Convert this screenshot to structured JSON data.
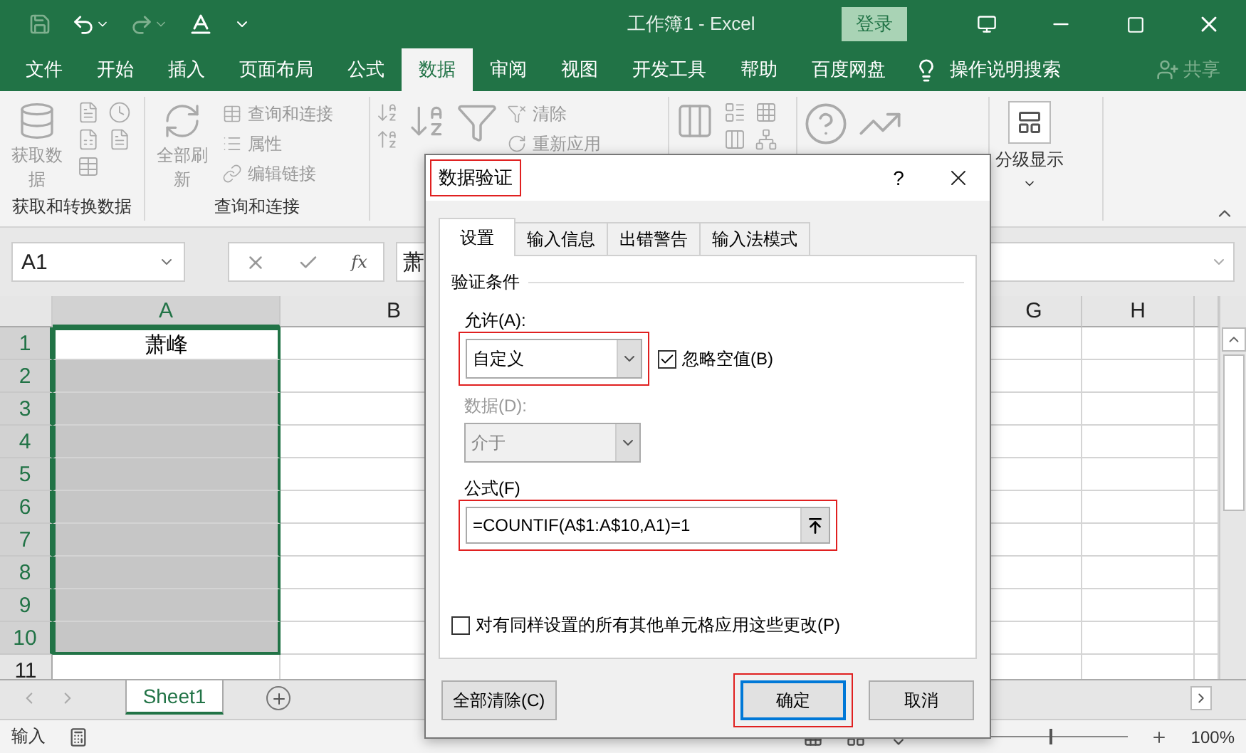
{
  "window": {
    "title": "工作簿1  -  Excel",
    "sign_in": "登录"
  },
  "menu_tabs": [
    {
      "label": "文件",
      "selected": false
    },
    {
      "label": "开始",
      "selected": false
    },
    {
      "label": "插入",
      "selected": false
    },
    {
      "label": "页面布局",
      "selected": false
    },
    {
      "label": "公式",
      "selected": false
    },
    {
      "label": "数据",
      "selected": true
    },
    {
      "label": "审阅",
      "selected": false
    },
    {
      "label": "视图",
      "selected": false
    },
    {
      "label": "开发工具",
      "selected": false
    },
    {
      "label": "帮助",
      "selected": false
    },
    {
      "label": "百度网盘",
      "selected": false
    }
  ],
  "tell_me": "操作说明搜索",
  "share": "共享",
  "ribbon": {
    "get_data": "获取数据",
    "refresh_all": "全部刷新",
    "queries": "查询和连接",
    "properties": "属性",
    "edit_links": "编辑链接",
    "clear": "清除",
    "reapply": "重新应用",
    "outline": "分级显示",
    "groups": [
      "获取和转换数据",
      "查询和连接"
    ]
  },
  "formula_bar": {
    "name_box": "A1",
    "fx": "fx",
    "content": "萧"
  },
  "columns": [
    {
      "label": "A",
      "selected": true
    },
    {
      "label": "B",
      "selected": false
    },
    {
      "label": "G",
      "selected": false
    },
    {
      "label": "H",
      "selected": false
    }
  ],
  "rows": [
    {
      "number": "1",
      "value": "萧峰",
      "selected": true,
      "active": true
    },
    {
      "number": "2",
      "selected": true,
      "active": false
    },
    {
      "number": "3",
      "selected": true,
      "active": false
    },
    {
      "number": "4",
      "selected": true,
      "active": false
    },
    {
      "number": "5",
      "selected": true,
      "active": false
    },
    {
      "number": "6",
      "selected": true,
      "active": false
    },
    {
      "number": "7",
      "selected": true,
      "active": false
    },
    {
      "number": "8",
      "selected": true,
      "active": false
    },
    {
      "number": "9",
      "selected": true,
      "active": false
    },
    {
      "number": "10",
      "selected": true,
      "active": false
    },
    {
      "number": "11",
      "selected": false,
      "active": false
    }
  ],
  "sheets": [
    {
      "label": "Sheet1",
      "selected": true
    }
  ],
  "status_bar": {
    "mode": "输入",
    "zoom": "100%",
    "zoom_slider": {
      "level": 0.5
    }
  },
  "dialog": {
    "title": "数据验证",
    "title_annotated": true,
    "help": "?",
    "tabs": [
      {
        "label": "设置",
        "selected": true
      },
      {
        "label": "输入信息",
        "selected": false
      },
      {
        "label": "出错警告",
        "selected": false
      },
      {
        "label": "输入法模式",
        "selected": false
      }
    ],
    "section": "验证条件",
    "allow": {
      "label": "允许(A):",
      "value": "自定义",
      "disabled": false,
      "annotated": true
    },
    "ignore_blank": {
      "label": "忽略空值(B)",
      "checked": true
    },
    "data": {
      "label": "数据(D):",
      "value": "介于",
      "disabled": true
    },
    "formula": {
      "label": "公式(F)",
      "value": "=COUNTIF(A$1:A$10,A1)=1",
      "annotated": true
    },
    "apply_all": {
      "label": "对有同样设置的所有其他单元格应用这些更改(P)",
      "checked": false
    },
    "buttons": [
      {
        "label": "全部清除(C)",
        "kind": "secondary",
        "annotated": false
      },
      {
        "label": "确定",
        "kind": "default",
        "annotated": true
      },
      {
        "label": "取消",
        "kind": "secondary",
        "annotated": false
      }
    ]
  }
}
